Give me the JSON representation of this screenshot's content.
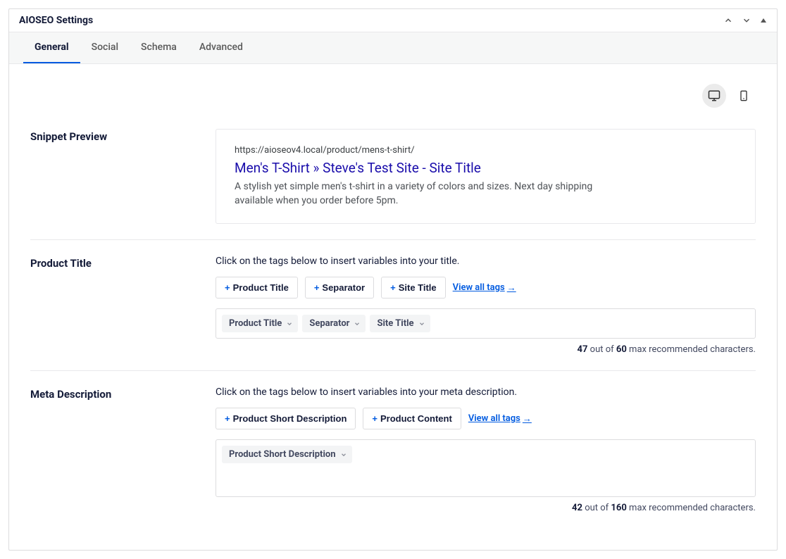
{
  "panel": {
    "title": "AIOSEO Settings"
  },
  "tabs": {
    "items": [
      "General",
      "Social",
      "Schema",
      "Advanced"
    ],
    "active": 0
  },
  "snippet": {
    "label": "Snippet Preview",
    "url": "https://aioseov4.local/product/mens-t-shirt/",
    "title": "Men's T-Shirt » Steve's Test Site - Site Title",
    "description": "A stylish yet simple men's t-shirt in a variety of colors and sizes. Next day shipping available when you order before 5pm."
  },
  "product_title": {
    "label": "Product Title",
    "instruction": "Click on the tags below to insert variables into your title.",
    "add_tags": [
      "Product Title",
      "Separator",
      "Site Title"
    ],
    "view_all": "View all tags",
    "chips": [
      "Product Title",
      "Separator",
      "Site Title"
    ],
    "count_current": "47",
    "count_max": "60",
    "count_text_1": " out of ",
    "count_text_2": " max recommended characters."
  },
  "meta_description": {
    "label": "Meta Description",
    "instruction": "Click on the tags below to insert variables into your meta description.",
    "add_tags": [
      "Product Short Description",
      "Product Content"
    ],
    "view_all": "View all tags",
    "chips": [
      "Product Short Description"
    ],
    "count_current": "42",
    "count_max": "160",
    "count_text_1": " out of ",
    "count_text_2": " max recommended characters."
  }
}
